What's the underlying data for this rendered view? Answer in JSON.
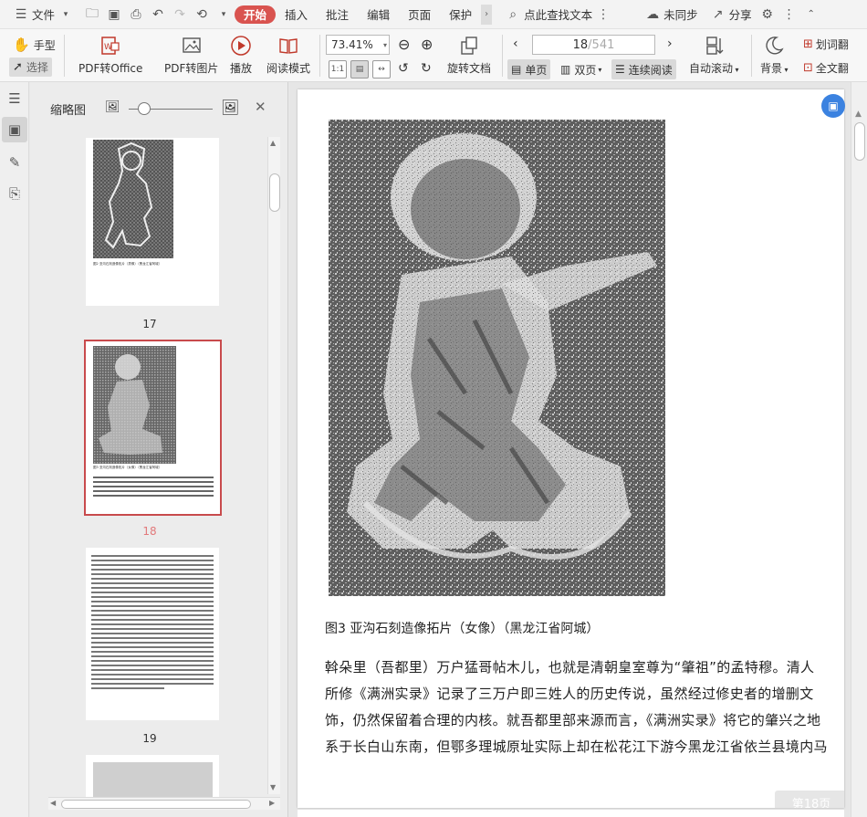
{
  "menubar": {
    "file_label": "文件",
    "tabs": [
      "开始",
      "插入",
      "批注",
      "编辑",
      "页面",
      "保护"
    ],
    "search_label": "点此查找文本",
    "sync_label": "未同步",
    "share_label": "分享"
  },
  "ribbon": {
    "hand_label": "手型",
    "select_label": "选择",
    "pdf_to_office": "PDF转Office",
    "pdf_to_image": "PDF转图片",
    "play": "播放",
    "read_mode": "阅读模式",
    "zoom": "73.41%",
    "rotate_doc": "旋转文档",
    "current_page": "18",
    "total_pages": "/541",
    "single_page": "单页",
    "double_page": "双页",
    "continuous": "连续阅读",
    "auto_scroll": "自动滚动",
    "background": "背景",
    "word_translate": "划词翻",
    "full_translate": "全文翻"
  },
  "thumbpanel": {
    "title": "缩略图",
    "pages": [
      {
        "num": "17",
        "caption": "图2 亚沟石刻造像拓片（男像）（黑龙江省阿城）"
      },
      {
        "num": "18",
        "caption": "图3 亚沟石刻造像拓片（女像）（黑龙江省阿城）"
      },
      {
        "num": "19",
        "caption": ""
      }
    ]
  },
  "document": {
    "caption": "图3  亚沟石刻造像拓片（女像）（黑龙江省阿城）",
    "paragraph_lines": [
      "斡朵里（吾都里）万户猛哥帖木儿，也就是清朝皇室尊为“肇祖”的孟特穆。清人",
      "所修《满洲实录》记录了三万户即三姓人的历史传说，虽然经过修史者的增删文",
      "饰，仍然保留着合理的内核。就吾都里部来源而言，《满洲实录》将它的肇兴之地",
      "系于长白山东南，但鄂多理城原址实际上却在松花江下游今黑龙江省依兰县境内马"
    ],
    "page_badge": "第18页"
  }
}
